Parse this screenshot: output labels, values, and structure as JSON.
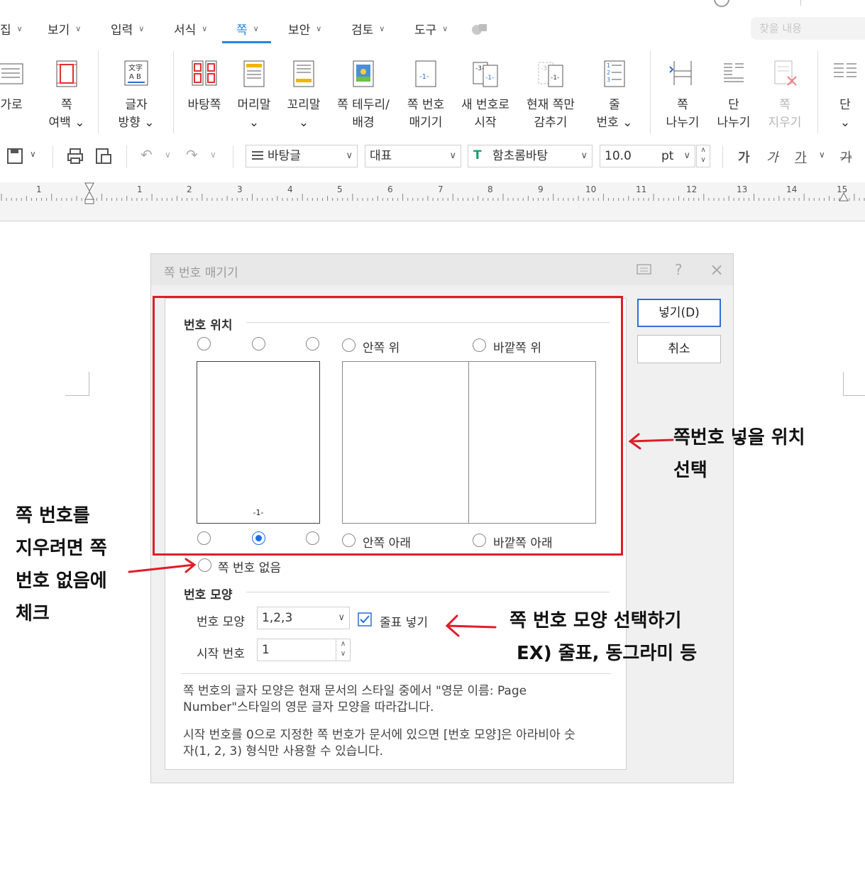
{
  "menu": {
    "tabs": [
      {
        "label": "집"
      },
      {
        "label": "보기"
      },
      {
        "label": "입력"
      },
      {
        "label": "서식"
      },
      {
        "label": "쪽"
      },
      {
        "label": "보안"
      },
      {
        "label": "검토"
      },
      {
        "label": "도구"
      }
    ],
    "search_placeholder": "찾을 내용"
  },
  "ribbon": {
    "items": [
      {
        "label1": "가로",
        "label2": ""
      },
      {
        "label1": "쪽",
        "label2": "여백 ⌄"
      },
      {
        "label1": "글자",
        "label2": "방향 ⌄"
      },
      {
        "label1": "바탕쪽",
        "label2": ""
      },
      {
        "label1": "머리말",
        "label2": "⌄"
      },
      {
        "label1": "꼬리말",
        "label2": "⌄"
      },
      {
        "label1": "쪽 테두리/",
        "label2": "배경"
      },
      {
        "label1": "쪽 번호",
        "label2": "매기기"
      },
      {
        "label1": "새 번호로",
        "label2": "시작"
      },
      {
        "label1": "현재 쪽만",
        "label2": "감추기"
      },
      {
        "label1": "줄",
        "label2": "번호 ⌄"
      },
      {
        "label1": "쪽",
        "label2": "나누기"
      },
      {
        "label1": "단",
        "label2": "나누기"
      },
      {
        "label1": "쪽",
        "label2": "지우기"
      },
      {
        "label1": "단",
        "label2": "⌄"
      }
    ]
  },
  "toolbar": {
    "style": "바탕글",
    "language": "대표",
    "font": "함초롬바탕",
    "size": "10.0",
    "unit": "pt",
    "fmt_bold": "가",
    "fmt_italic": "가",
    "fmt_underline": "가",
    "fmt_strike": "가"
  },
  "ruler": {
    "numbers": [
      "1",
      "1",
      "2",
      "3",
      "4",
      "5",
      "6",
      "7",
      "8",
      "9",
      "10",
      "11",
      "12",
      "13",
      "14",
      "15"
    ]
  },
  "dialog": {
    "title": "쪽 번호 매기기",
    "insert_button": "넣기(D)",
    "cancel_button": "취소",
    "position_section": "번호 위치",
    "inner_top": "안쪽 위",
    "outer_top": "바깥쪽 위",
    "inner_bottom": "안쪽 아래",
    "outer_bottom": "바깥쪽 아래",
    "page_sample": "-1-",
    "no_number": "쪽 번호 없음",
    "shape_section": "번호 모양",
    "shape_label": "번호 모양",
    "shape_value": "1,2,3",
    "dash_checkbox": "줄표 넣기",
    "dash_checked": true,
    "start_label": "시작 번호",
    "start_value": "1",
    "info1_line1": "쪽 번호의 글자 모양은 현재 문서의 스타일 중에서 \"영문 이름: Page",
    "info1_line2": "Number\"스타일의 영문 글자 모양을 따라갑니다.",
    "info2_line1": "시작 번호를 0으로 지정한 쪽 번호가 문서에 있으면 [번호 모양]은 아라비아 숫",
    "info2_line2": "자(1, 2, 3) 형식만 사용할 수 있습니다."
  },
  "annotations": {
    "position_note_1": "쪽번호 넣을 위치",
    "position_note_2": "선택",
    "remove_note_1": "쪽 번호를",
    "remove_note_2": "지우려면 쪽",
    "remove_note_3": "번호 없음에",
    "remove_note_4": "체크",
    "shape_note_1": "쪽 번호 모양 선택하기",
    "shape_note_2": "EX) 줄표, 동그라미 등",
    "highlight_color": "#e01d2a"
  }
}
